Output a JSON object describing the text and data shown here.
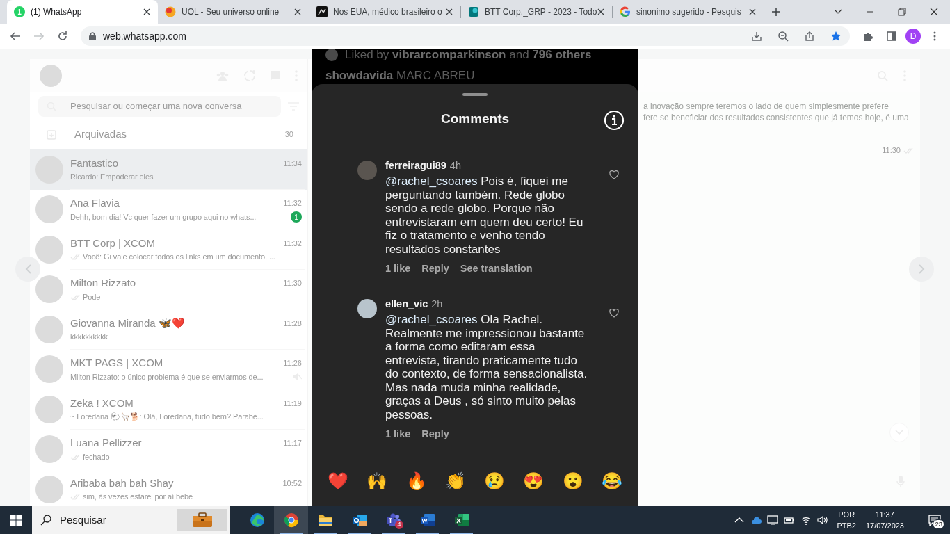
{
  "browser": {
    "tabs": [
      {
        "title": "(1) WhatsApp",
        "badge": "1",
        "selected": true
      },
      {
        "title": "UOL - Seu universo online",
        "selected": false
      },
      {
        "title": "Nos EUA, médico brasileiro o",
        "selected": false
      },
      {
        "title": "BTT Corp._GRP - 2023 - Todo",
        "selected": false
      },
      {
        "title": "sinonimo sugerido - Pesquis",
        "selected": false
      }
    ],
    "toolbar": {
      "url": "web.whatsapp.com",
      "forward_disabled": true,
      "bookmarked": true,
      "profile": "D"
    }
  },
  "whatsapp": {
    "search_placeholder": "Pesquisar ou começar uma nova conversa",
    "archived": {
      "label": "Arquivadas",
      "count": "30"
    },
    "chats": [
      {
        "name": "Fantastico",
        "time": "11:34",
        "preview": "Ricardo: Empoderar eles",
        "sent": false,
        "muted": false,
        "selected": true
      },
      {
        "name": "Ana Flavia",
        "time": "11:32",
        "preview": "Dehh, bom dia! Vc quer fazer um grupo aqui no whats...",
        "unread": "1",
        "sent": false,
        "muted": false,
        "selected": false
      },
      {
        "name": "BTT Corp | XCOM",
        "time": "11:32",
        "preview": "Você: Gi vale colocar todos os links em um documento, ...",
        "sent": true,
        "muted": false,
        "selected": false
      },
      {
        "name": "Milton Rizzato",
        "time": "11:30",
        "preview": "Pode",
        "sent": true,
        "muted": false,
        "selected": false
      },
      {
        "name": "Giovanna Miranda 🦋❤️",
        "time": "11:28",
        "preview": "kkkkkkkkkk",
        "sent": false,
        "muted": false,
        "selected": false
      },
      {
        "name": "MKT PAGS | XCOM",
        "time": "11:26",
        "preview": "Milton Rizzato: o único problema é que se enviarmos de...",
        "sent": false,
        "muted": true,
        "selected": false
      },
      {
        "name": "Zeka ! XCOM",
        "time": "11:19",
        "preview": "~ Loredana 🐑🦙🐕: Olá, Loredana, tudo bem? Parabé...",
        "sent": false,
        "muted": false,
        "selected": false
      },
      {
        "name": "Luana Pellizzer",
        "time": "11:17",
        "preview": "fechado",
        "sent": true,
        "muted": false,
        "selected": false
      },
      {
        "name": "Aribaba bah bah Shay",
        "time": "10:52",
        "preview": "sim, às vezes estarei por aí bebe",
        "sent": true,
        "muted": false,
        "selected": false
      }
    ],
    "open_chat": {
      "lines": [
        "a inovação sempre teremos o lado de quem simplesmente prefere",
        "fere se beneficiar dos resultados consistentes que já temos hoje, é uma"
      ],
      "time": "11:30",
      "sent": true
    }
  },
  "viewer": {
    "liked_by": "Liked by **vibrarcomparkinson** and **796 others**",
    "caption": "**showdavida** MARC ABREU",
    "title": "Comments",
    "comments": [
      {
        "user": "ferreiragui89",
        "time": "4h",
        "mention": "@rachel_csoares",
        "text": "Pois é, fiquei me perguntando também. Rede globo sendo a rede globo. Porque não entrevistaram em quem deu certo! Eu fiz o tratamento e venho tendo resultados constantes",
        "likes": "1 like",
        "reply": "Reply",
        "translation": "See translation"
      },
      {
        "user": "ellen_vic",
        "time": "2h",
        "mention": "@rachel_csoares",
        "text": "Ola Rachel. Realmente me impressionou bastante a forma como editaram essa entrevista, tirando praticamente tudo do contexto, de forma sensacionalista. Mas nada muda minha realidade, graças a Deus , só sinto muito pelas pessoas.",
        "likes": "1 like",
        "reply": "Reply"
      }
    ],
    "reactions": [
      "❤️",
      "🙌",
      "🔥",
      "👏",
      "😢",
      "😍",
      "😮",
      "😂"
    ]
  },
  "taskbar": {
    "search": "Pesquisar",
    "apps": [
      {
        "running": false,
        "active": false
      },
      {
        "running": true,
        "active": true
      },
      {
        "running": true,
        "active": false
      },
      {
        "running": true,
        "active": false
      },
      {
        "running": true,
        "active": false,
        "badge": "4"
      },
      {
        "running": true,
        "active": false
      },
      {
        "running": true,
        "active": false
      }
    ],
    "tray": {
      "language": "POR",
      "layout": "PTB2",
      "time": "11:37",
      "date": "17/07/2023",
      "notifications": "23"
    }
  }
}
